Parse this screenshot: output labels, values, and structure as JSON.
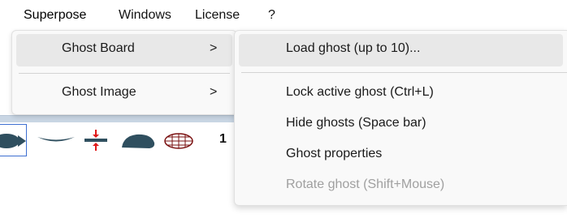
{
  "menubar": {
    "items": [
      {
        "label": "Superpose"
      },
      {
        "label": "Windows"
      },
      {
        "label": "License"
      },
      {
        "label": "?"
      }
    ]
  },
  "superpose_menu": {
    "items": [
      {
        "label": "Ghost Board",
        "chevron": ">",
        "highlighted": true
      },
      {
        "label": "Ghost Image",
        "chevron": ">",
        "highlighted": false
      }
    ]
  },
  "ghost_board_menu": {
    "items": [
      {
        "label": "Load ghost (up to 10)...",
        "highlighted": true,
        "enabled": true
      },
      {
        "label": "Lock active ghost (Ctrl+L)",
        "highlighted": false,
        "enabled": true
      },
      {
        "label": "Hide ghosts (Space bar)",
        "highlighted": false,
        "enabled": true
      },
      {
        "label": "Ghost properties",
        "highlighted": false,
        "enabled": true
      },
      {
        "label": "Rotate ghost (Shift+Mouse)",
        "highlighted": false,
        "enabled": false
      }
    ]
  },
  "toolbar": {
    "number_text": "1",
    "shape_icons": [
      "convex-lens-icon",
      "concave-lens-icon",
      "split-arrows-icon",
      "blob-icon",
      "globe-grid-icon"
    ]
  },
  "colors": {
    "menu_bg": "#f9f9f9",
    "menu_highlight": "#e8e8e8",
    "disabled_text": "#a0a0a0",
    "selection_border": "#3d6fd1",
    "shape_fill": "#2f4f5f",
    "arrow_red": "#e01818"
  }
}
